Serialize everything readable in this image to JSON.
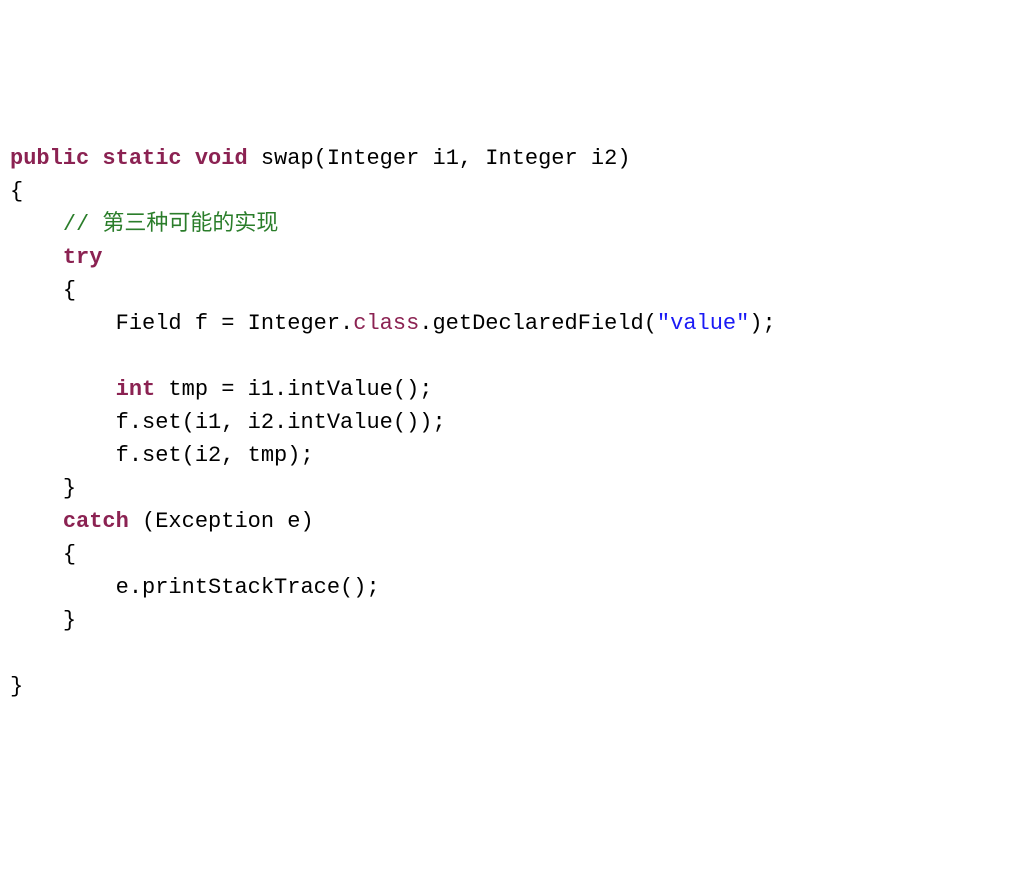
{
  "code": {
    "l1_kw1": "public",
    "l1_sp1": " ",
    "l1_kw2": "static",
    "l1_sp2": " ",
    "l1_kw3": "void",
    "l1_sp3": " ",
    "l1_func": "swap(Integer i1, Integer i2)",
    "l2": "{",
    "l3_indent": "    ",
    "l3_comment": "// 第三种可能的实现",
    "l4_indent": "    ",
    "l4_kw": "try",
    "l5_indent": "    ",
    "l5_brace": "{",
    "l6_indent": "        ",
    "l6_a": "Field f = Integer.",
    "l6_class": "class",
    "l6_b": ".getDeclaredField(",
    "l6_str": "\"value\"",
    "l6_c": ");",
    "l7_blank": "",
    "l8_indent": "        ",
    "l8_kw": "int",
    "l8_rest": " tmp = i1.intValue();",
    "l9_indent": "        ",
    "l9_text": "f.set(i1, i2.intValue());",
    "l10_indent": "        ",
    "l10_text": "f.set(i2, tmp);",
    "l11_indent": "    ",
    "l11_brace": "}",
    "l12_indent": "    ",
    "l12_kw": "catch",
    "l12_rest": " (Exception e)",
    "l13_indent": "    ",
    "l13_brace": "{",
    "l14_indent": "        ",
    "l14_text": "e.printStackTrace();",
    "l15_indent": "    ",
    "l15_brace": "}",
    "l16_blank": "",
    "l17": "}"
  }
}
